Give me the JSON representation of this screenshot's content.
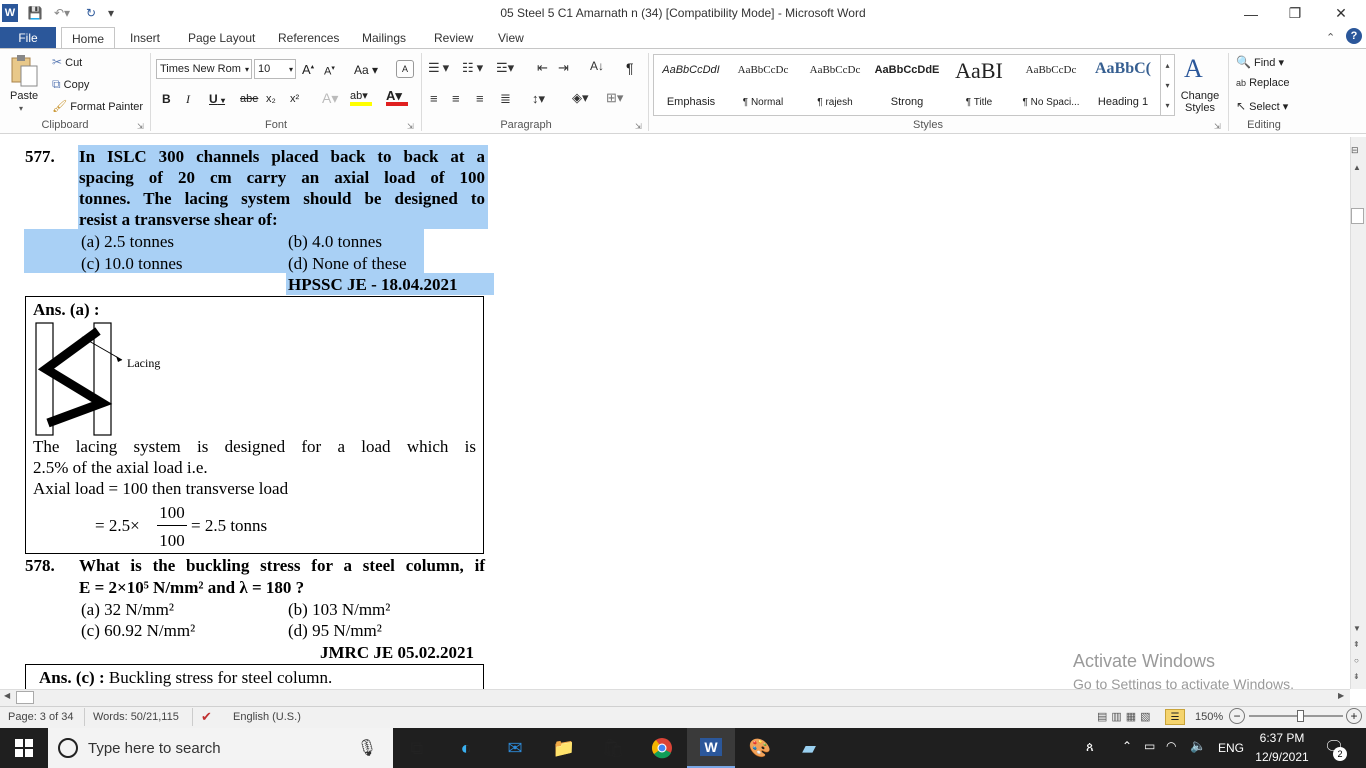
{
  "window": {
    "title": "05 Steel 5  C1 Amarnath n (34) [Compatibility Mode] - Microsoft Word",
    "minimize": "—",
    "restore": "❐",
    "close": "✕"
  },
  "tabs": {
    "file": "File",
    "items": [
      "Home",
      "Insert",
      "Page Layout",
      "References",
      "Mailings",
      "Review",
      "View"
    ],
    "active": "Home"
  },
  "clipboard": {
    "paste": "Paste",
    "cut": "Cut",
    "copy": "Copy",
    "format_painter": "Format Painter",
    "label": "Clipboard"
  },
  "font": {
    "family": "Times New Rom",
    "size": "10",
    "grow": "A",
    "shrink": "A",
    "case": "Aa",
    "bold": "B",
    "italic": "I",
    "underline": "U",
    "strike": "abe",
    "subscript": "x₂",
    "superscript": "x²",
    "label": "Font"
  },
  "paragraph": {
    "label": "Paragraph",
    "pilcrow": "¶"
  },
  "styles": {
    "label": "Styles",
    "items": [
      {
        "preview": "AaBbCcDdI",
        "name": "Emphasis"
      },
      {
        "preview": "AaBbCcDc",
        "name": "¶ Normal"
      },
      {
        "preview": "AaBbCcDc",
        "name": "¶ rajesh"
      },
      {
        "preview": "AaBbCcDdE",
        "name": "Strong"
      },
      {
        "preview": "AaBI",
        "name": "¶ Title"
      },
      {
        "preview": "AaBbCcDc",
        "name": "¶ No Spaci..."
      },
      {
        "preview": "AaBbC(",
        "name": "Heading 1"
      }
    ],
    "change_styles": "Change Styles"
  },
  "editing": {
    "find": "Find",
    "replace": "Replace",
    "select": "Select",
    "label": "Editing"
  },
  "document": {
    "q577": {
      "number": "577.",
      "line1": "In ISLC 300 channels placed back to back at a",
      "line2": "spacing of 20 cm carry an axial load of 100",
      "line3": "tonnes. The lacing system should be designed to",
      "line4": "resist a transverse shear of:",
      "opt_a": "(a)  2.5 tonnes",
      "opt_b": "(b)  4.0 tonnes",
      "opt_c": "(c)  10.0 tonnes",
      "opt_d": "(d)  None of these",
      "source": "HPSSC JE - 18.04.2021"
    },
    "ans577": {
      "head": "Ans. (a) :",
      "lacing_label": "Lacing",
      "line1": "The lacing system is designed for a load which is",
      "line2": "2.5% of the axial load i.e.",
      "line3": "Axial load = 100 then transverse load",
      "eq_prefix": "=  2.5×",
      "eq_num": "100",
      "eq_den": "100",
      "eq_suffix": "= 2.5 tonns"
    },
    "q578": {
      "number": "578.",
      "line1": "What is the buckling stress for a steel column, if",
      "line2": "E = 2×10⁵ N/mm² and λ = 180 ?",
      "opt_a": "(a)  32 N/mm²",
      "opt_b": "(b)  103 N/mm²",
      "opt_c": "(c)  60.92 N/mm²",
      "opt_d": "(d)  95 N/mm²",
      "source": "JMRC JE 05.02.2021"
    },
    "ans578": {
      "head": "Ans. (c) :",
      "text": "Buckling stress for steel column."
    }
  },
  "watermark": {
    "line1": "Activate Windows",
    "line2": "Go to Settings to activate Windows."
  },
  "status": {
    "page": "Page: 3 of 34",
    "words": "Words: 50/21,115",
    "language": "English (U.S.)",
    "zoom": "150%"
  },
  "taskbar": {
    "search_placeholder": "Type here to search",
    "language": "ENG",
    "time": "6:37 PM",
    "date": "12/9/2021",
    "notifications": "2"
  }
}
